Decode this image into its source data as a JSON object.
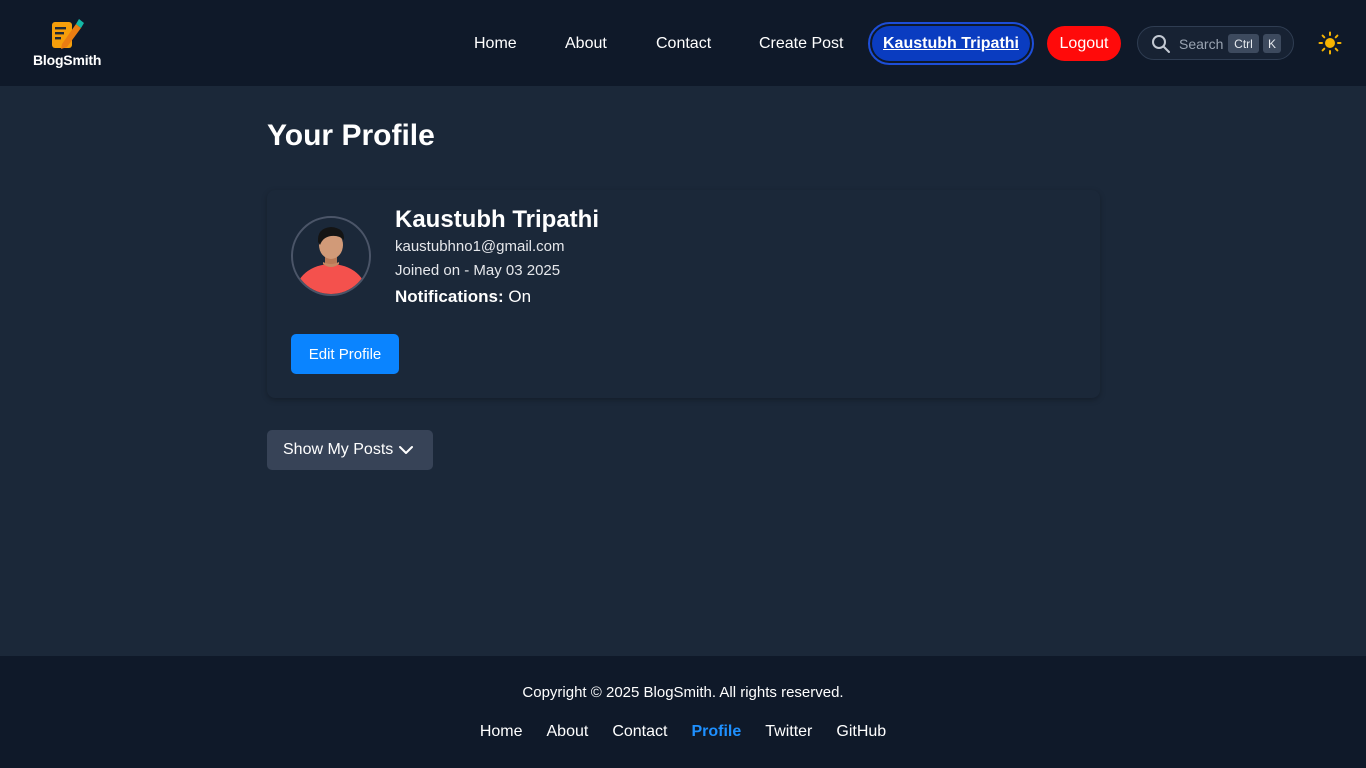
{
  "brand": {
    "name": "BlogSmith",
    "icon": "notepad-pencil-icon"
  },
  "nav": {
    "links": [
      "Home",
      "About",
      "Contact",
      "Create Post"
    ],
    "user_button": "Kaustubh Tripathi",
    "logout": "Logout",
    "search": {
      "placeholder": "Search",
      "shortcut": [
        "Ctrl",
        "K"
      ]
    },
    "theme_icon": "sun-icon"
  },
  "page": {
    "title": "Your Profile"
  },
  "profile": {
    "name": "Kaustubh Tripathi",
    "email": "kaustubhno1@gmail.com",
    "joined": "Joined on - May 03 2025",
    "notifications_label": "Notifications:",
    "notifications_value": "On",
    "edit_button": "Edit Profile",
    "avatar_icon": "user-avatar-icon"
  },
  "posts_toggle": {
    "label": "Show My Posts",
    "icon": "chevron-down-icon"
  },
  "footer": {
    "copyright": "Copyright © 2025 BlogSmith. All rights reserved.",
    "links": [
      "Home",
      "About",
      "Contact",
      "Profile",
      "Twitter",
      "GitHub"
    ],
    "active_link": "Profile"
  },
  "colors": {
    "header_bg": "#0f1929",
    "body_bg": "#1b2839",
    "user_btn": "#0a3cc0",
    "logout": "#ff0a0a",
    "primary": "#0a84ff",
    "active_link": "#1e90ff"
  }
}
